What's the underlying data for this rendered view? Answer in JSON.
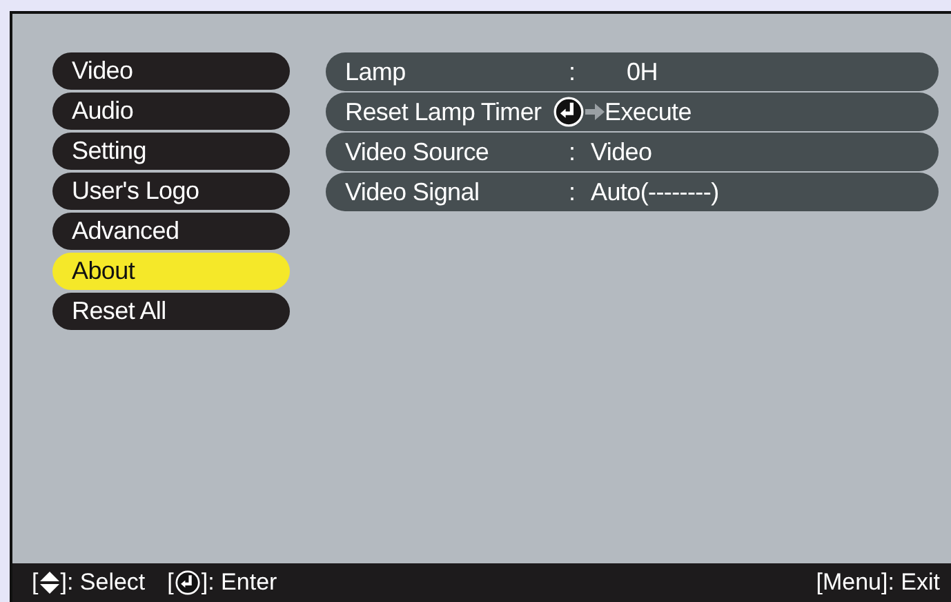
{
  "menu": [
    {
      "label": "Video",
      "selected": false
    },
    {
      "label": "Audio",
      "selected": false
    },
    {
      "label": "Setting",
      "selected": false
    },
    {
      "label": "User's Logo",
      "selected": false
    },
    {
      "label": "Advanced",
      "selected": false
    },
    {
      "label": "About",
      "selected": true
    },
    {
      "label": "Reset All",
      "selected": false
    }
  ],
  "rows": [
    {
      "kind": "value",
      "label": "Lamp",
      "separator": ":",
      "value": "0H"
    },
    {
      "kind": "action",
      "label": "Reset Lamp Timer",
      "value": "Execute"
    },
    {
      "kind": "value",
      "label": "Video Source",
      "separator": ":",
      "value": "Video"
    },
    {
      "kind": "value",
      "label": "Video Signal",
      "separator": ":",
      "value": "Auto(--------)"
    }
  ],
  "footer": {
    "left": [
      {
        "kind": "updown",
        "open": "[",
        "close": "]: Select"
      },
      {
        "kind": "enter",
        "open": "[",
        "close": "]: Enter"
      }
    ],
    "right": "[Menu]: Exit"
  }
}
